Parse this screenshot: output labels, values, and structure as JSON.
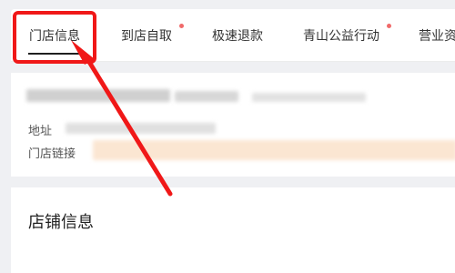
{
  "tabs": [
    {
      "label": "门店信息",
      "active": true,
      "has_dot": false
    },
    {
      "label": "到店自取",
      "active": false,
      "has_dot": true
    },
    {
      "label": "极速退款",
      "active": false,
      "has_dot": false
    },
    {
      "label": "青山公益行动",
      "active": false,
      "has_dot": true
    },
    {
      "label": "营业资",
      "active": false,
      "has_dot": false
    }
  ],
  "store": {
    "address_label": "地址",
    "link_label": "门店链接"
  },
  "sections": {
    "store_info_title": "店铺信息"
  },
  "colors": {
    "annotation": "#f01818",
    "dot": "#f06a6a",
    "page_bg": "#eff0f3"
  }
}
